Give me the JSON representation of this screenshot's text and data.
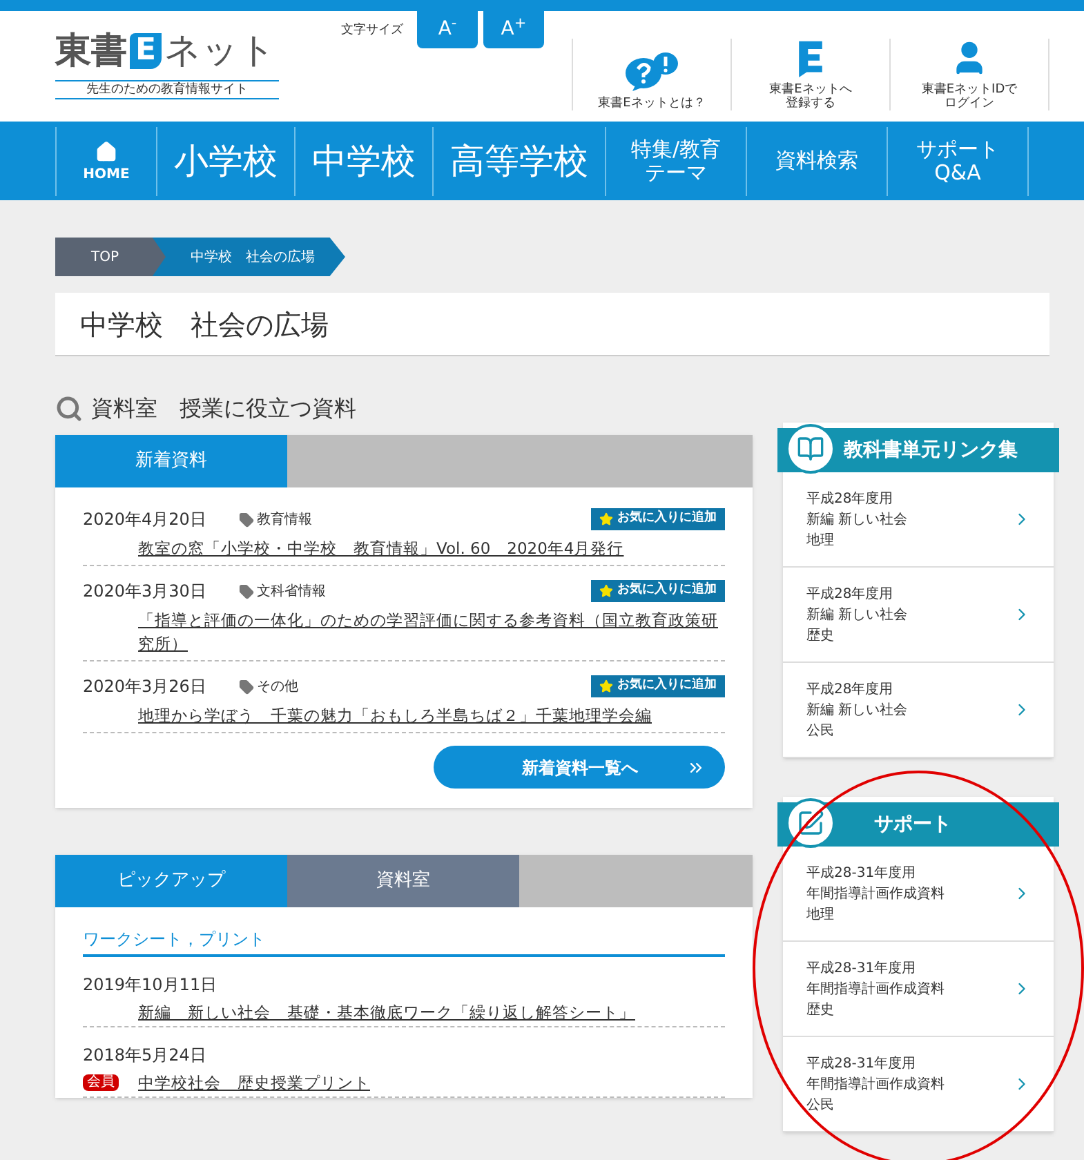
{
  "header": {
    "logo": {
      "left": "東書",
      "mark": "E",
      "right": "ネット"
    },
    "tagline": "先生のための教育情報サイト",
    "font_size": {
      "label": "文字サイズ",
      "buttons": [
        "A$^{-}$",
        "A$^{+}$"
      ]
    },
    "links": [
      {
        "kind": "help",
        "lines": [
          "東書Eネットとは？"
        ]
      },
      {
        "kind": "register",
        "lines": [
          "東書Eネットへ",
          "登録する"
        ]
      },
      {
        "kind": "login",
        "lines": [
          "東書EネットIDで",
          "ログイン"
        ]
      }
    ]
  },
  "nav": [
    {
      "kind": "home",
      "lines": [
        "HOME"
      ]
    },
    {
      "kind": "large",
      "lines": [
        "小学校"
      ]
    },
    {
      "kind": "large",
      "lines": [
        "中学校"
      ]
    },
    {
      "kind": "large",
      "lines": [
        "高等学校"
      ]
    },
    {
      "kind": "small",
      "lines": [
        "特集/教育",
        "テーマ"
      ]
    },
    {
      "kind": "small",
      "lines": [
        "資料検索"
      ]
    },
    {
      "kind": "small",
      "lines": [
        "サポート",
        "Q&A"
      ]
    }
  ],
  "breadcrumb": [
    "TOP",
    "中学校　社会の広場"
  ],
  "page_title": "中学校　社会の広場",
  "section_heading": "資料室　授業に役立つ資料",
  "new_panel": {
    "tabs": [
      {
        "label": "新着資料",
        "selected": true
      }
    ],
    "items": [
      {
        "date": "2020年4月20日",
        "tag": "教育情報",
        "favorite": "お気に入りに追加",
        "title": "教室の窓「小学校・中学校　教育情報」Vol. 60　2020年4月発行"
      },
      {
        "date": "2020年3月30日",
        "tag": "文科省情報",
        "favorite": "お気に入りに追加",
        "title": "「指導と評価の一体化」のための学習評価に関する参考資料（国立教育政策研究所）"
      },
      {
        "date": "2020年3月26日",
        "tag": "その他",
        "favorite": "お気に入りに追加",
        "title": "地理から学ぼう　千葉の魅力「おもしろ半島ちば２」千葉地理学会編"
      }
    ],
    "more_button": "新着資料一覧へ"
  },
  "pickup_panel": {
    "tabs": [
      {
        "label": "ピックアップ",
        "selected": true
      },
      {
        "label": "資料室",
        "selected": false
      }
    ],
    "category": "ワークシート，プリント",
    "items": [
      {
        "date": "2019年10月11日",
        "members_only": false,
        "title": "新編　新しい社会　基礎・基本徹底ワーク「繰り返し解答シート」"
      },
      {
        "date": "2018年5月24日",
        "members_only": true,
        "badge": "会員",
        "title": "中学校社会　歴史授業プリント"
      }
    ]
  },
  "sidebar": [
    {
      "kind": "book",
      "title": "教科書単元リンク集",
      "items": [
        [
          "平成28年度用",
          "新編 新しい社会",
          "地理"
        ],
        [
          "平成28年度用",
          "新編 新しい社会",
          "歴史"
        ],
        [
          "平成28年度用",
          "新編 新しい社会",
          "公民"
        ]
      ]
    },
    {
      "kind": "support",
      "title": "サポート",
      "items": [
        [
          "平成28-31年度用",
          "年間指導計画作成資料",
          "地理"
        ],
        [
          "平成28-31年度用",
          "年間指導計画作成資料",
          "歴史"
        ],
        [
          "平成28-31年度用",
          "年間指導計画作成資料",
          "公民"
        ]
      ]
    }
  ]
}
